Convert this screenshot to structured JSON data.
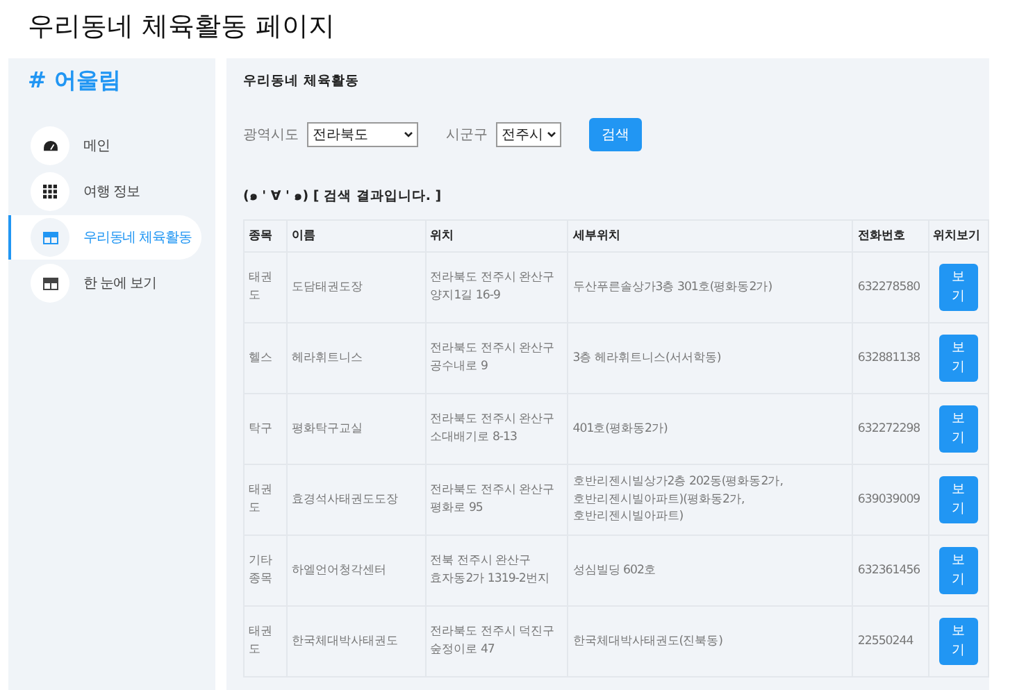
{
  "page_title": "우리동네 체육활동 페이지",
  "sidebar": {
    "logo": "# 어울림",
    "items": [
      {
        "label": "메인",
        "kind": "gauge",
        "selected": false
      },
      {
        "label": "여행 정보",
        "kind": "grid",
        "selected": false
      },
      {
        "label": "우리동네 체육활동",
        "kind": "table",
        "selected": true
      },
      {
        "label": "한 눈에 보기",
        "kind": "table",
        "selected": false
      }
    ]
  },
  "panel": {
    "heading": "우리동네 체육활동",
    "filters": [
      {
        "label": "광역시도",
        "value": "전라북도"
      },
      {
        "label": "시군구",
        "value": "전주시"
      }
    ],
    "search_button": "검색",
    "result_title": "(๑ ' ∀ ' ๑) [ 검색 결과입니다. ]",
    "table": {
      "columns": [
        "종목",
        "이름",
        "위치",
        "세부위치",
        "전화번호",
        "위치보기"
      ],
      "rows": [
        {
          "cells": [
            "태권도",
            "도담태권도장",
            "전라북도 전주시 완산구 양지1길 16-9",
            "두산푸른솔상가3층 301호(평화동2가)",
            "632278580"
          ],
          "button": "보기"
        },
        {
          "cells": [
            "헬스",
            "헤라휘트니스",
            "전라북도 전주시 완산구 공수내로 9",
            "3층 헤라휘트니스(서서학동)",
            "632881138"
          ],
          "button": "보기"
        },
        {
          "cells": [
            "탁구",
            "평화탁구교실",
            "전라북도 전주시 완산구 소대배기로 8-13",
            "401호(평화동2가)",
            "632272298"
          ],
          "button": "보기"
        },
        {
          "cells": [
            "태권도",
            "효경석사태권도도장",
            "전라북도 전주시 완산구 평화로 95",
            "호반리젠시빌상가2층 202동(평화동2가, 호반리젠시빌아파트)(평화동2가, 호반리젠시빌아파트)",
            "639039009"
          ],
          "button": "보기"
        },
        {
          "cells": [
            "기타종목",
            "하엘언어청각센터",
            "전북 전주시 완산구 효자동2가 1319-2번지",
            "성심빌딩 602호",
            "632361456"
          ],
          "button": "보기"
        },
        {
          "cells": [
            "태권도",
            "한국체대박사태권도",
            "전라북도 전주시 덕진구 숲정이로 47",
            "한국체대박사태권도(진북동)",
            "22550244"
          ],
          "button": "보기"
        }
      ]
    }
  }
}
